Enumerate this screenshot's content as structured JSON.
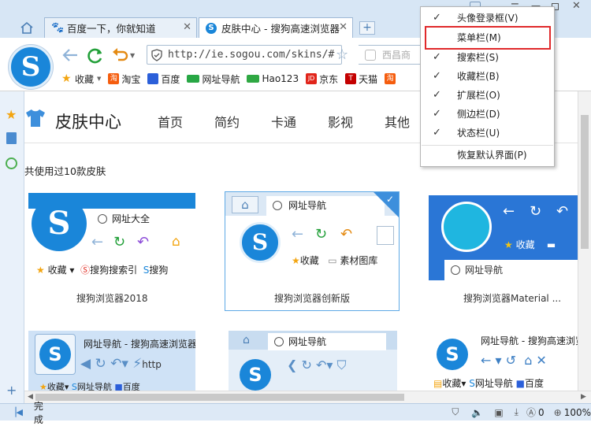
{
  "tabs": [
    {
      "label": "百度一下，你就知道",
      "active": false
    },
    {
      "label": "皮肤中心 - 搜狗高速浏览器",
      "active": true
    }
  ],
  "toolbar": {
    "url": "http://ie.sogou.com/skins/#",
    "search_placeholder": "西昌商"
  },
  "bookmarks": [
    "收藏",
    "淘宝",
    "百度",
    "网址导航",
    "Hao123",
    "京东",
    "天猫",
    "淘"
  ],
  "header": {
    "title": "皮肤中心",
    "nav": [
      "首页",
      "简约",
      "卡通",
      "影视",
      "其他"
    ]
  },
  "used_count_text": "共使用过10款皮肤",
  "skins": [
    {
      "name": "搜狗浏览器2018",
      "addr": "网址大全",
      "fav": "收藏",
      "link1": "搜狗搜索引",
      "link2": "搜狗"
    },
    {
      "name": "搜狗浏览器创新版",
      "addr": "网址导航",
      "fav": "收藏",
      "link1": "素材图库",
      "selected": true
    },
    {
      "name": "搜狗浏览器Material ...",
      "addr": "网址导航",
      "fav": "收藏"
    },
    {
      "name": "",
      "addr": "网址导航 - 搜狗高速浏览器",
      "fav": "收藏",
      "link1": "网址导航",
      "link2": "百度",
      "url_part": "http"
    },
    {
      "name": "",
      "addr": "网址导航"
    },
    {
      "name": "",
      "addr": "网址导航 - 搜狗高速浏览器",
      "fav": "收藏",
      "link1": "网址导航",
      "link2": "百度"
    }
  ],
  "menu": {
    "items": [
      {
        "label": "头像登录框(V)",
        "checked": true
      },
      {
        "label": "菜单栏(M)",
        "checked": false,
        "highlighted": true
      },
      {
        "label": "搜索栏(S)",
        "checked": true
      },
      {
        "label": "收藏栏(B)",
        "checked": true
      },
      {
        "label": "扩展栏(O)",
        "checked": true
      },
      {
        "label": "侧边栏(D)",
        "checked": true
      },
      {
        "label": "状态栏(U)",
        "checked": true
      }
    ],
    "restore": "恢复默认界面(P)"
  },
  "status": {
    "text": "完成",
    "count": "0",
    "zoom": "100%"
  },
  "colors": {
    "accent": "#1a86d9",
    "tabbar": "#d7e6f5",
    "menu_highlight": "#e0292b"
  }
}
